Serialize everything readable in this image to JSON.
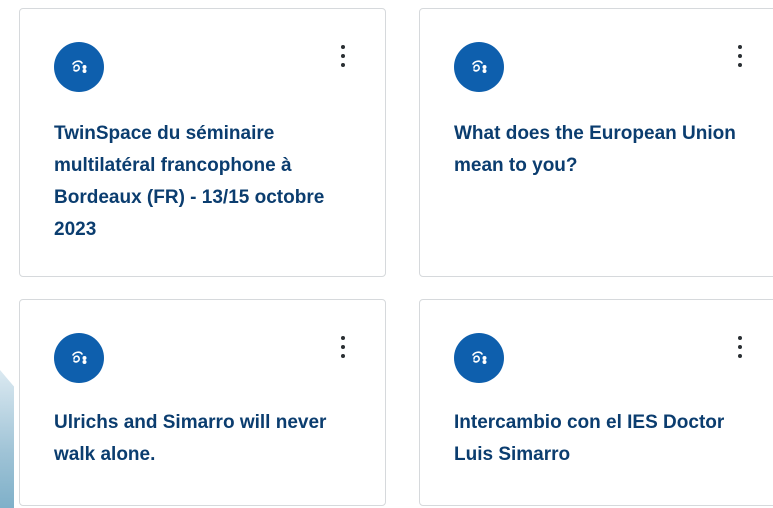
{
  "cards": [
    {
      "title": "TwinSpace du séminaire multilatéral francophone à Bordeaux (FR) - 13/15 octobre 2023",
      "icon": "project-logo-icon",
      "menu_icon": "more-vertical-icon"
    },
    {
      "title": "What does the European Union mean to you?",
      "icon": "project-logo-icon",
      "menu_icon": "more-vertical-icon"
    },
    {
      "title": "Ulrichs and Simarro will never walk alone.",
      "icon": "project-logo-icon",
      "menu_icon": "more-vertical-icon"
    },
    {
      "title": "Intercambio con el IES Doctor Luis Simarro",
      "icon": "project-logo-icon",
      "menu_icon": "more-vertical-icon"
    }
  ],
  "colors": {
    "title": "#0b3d6f",
    "logo_bg": "#0e5fad",
    "card_border": "#d6d9dc"
  }
}
